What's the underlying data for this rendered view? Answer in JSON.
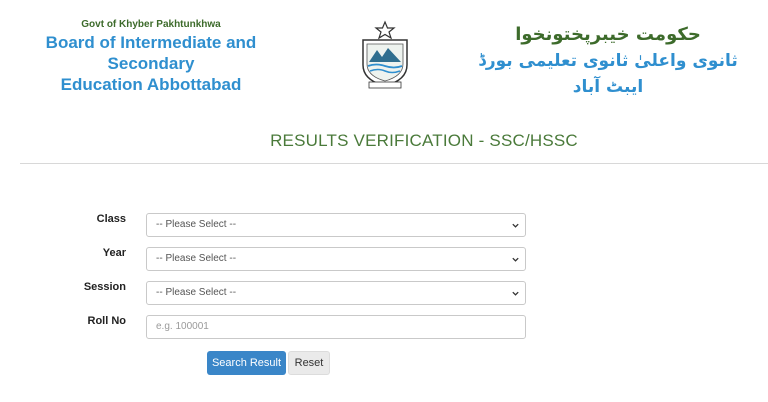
{
  "header": {
    "govt_label": "Govt of Khyber Pakhtunkhwa",
    "board_line1": "Board of Intermediate and Secondary",
    "board_line2": "Education Abbottabad",
    "urdu_line1": "حکومت خیبرپختونخوا",
    "urdu_line2": "ثانوی واعلیٰ ثانوی تعلیمی بورڈ ایبٹ آباد"
  },
  "page_title": "RESULTS VERIFICATION - SSC/HSSC",
  "form": {
    "class": {
      "label": "Class",
      "value": "-- Please Select --"
    },
    "year": {
      "label": "Year",
      "value": "-- Please Select --"
    },
    "session": {
      "label": "Session",
      "value": "-- Please Select --"
    },
    "roll_no": {
      "label": "Roll No",
      "placeholder": "e.g. 100001"
    }
  },
  "buttons": {
    "search": "Search Result",
    "reset": "Reset"
  },
  "colors": {
    "brand_green": "#3d6b2b",
    "brand_blue": "#2f8fcf",
    "primary_button": "#3a86c8"
  }
}
